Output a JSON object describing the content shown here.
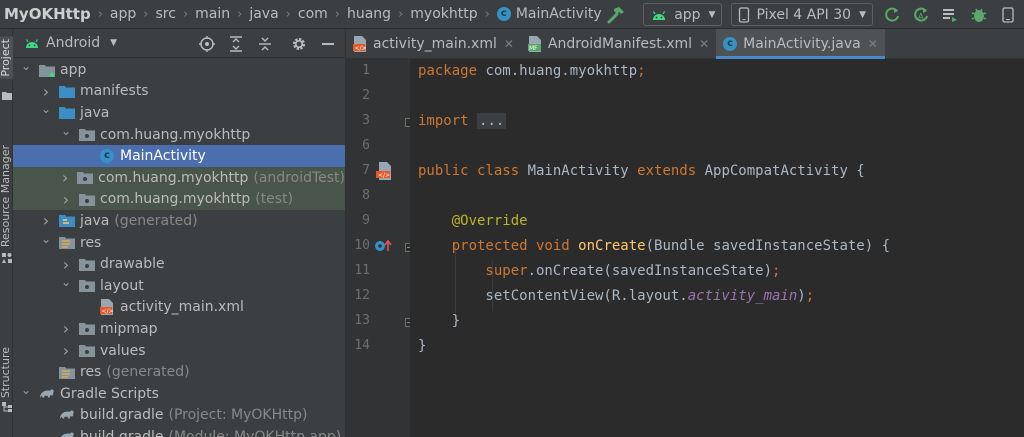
{
  "breadcrumbs": [
    {
      "label": "MyOKHttp",
      "kind": "root"
    },
    {
      "label": "app"
    },
    {
      "label": "src"
    },
    {
      "label": "main"
    },
    {
      "label": "java"
    },
    {
      "label": "com"
    },
    {
      "label": "huang"
    },
    {
      "label": "myokhttp"
    },
    {
      "label": "MainActivity",
      "kind": "class"
    }
  ],
  "toolbar": {
    "run_config": "app",
    "device": "Pixel 4 API 30"
  },
  "tool_stripe": {
    "project": "Project",
    "resource_manager": "Resource Manager",
    "structure": "Structure"
  },
  "project_panel": {
    "view_mode": "Android",
    "tree": [
      {
        "label": "app",
        "depth": 0,
        "arrow": "down",
        "icon": "module-icon"
      },
      {
        "label": "manifests",
        "depth": 1,
        "arrow": "right",
        "icon": "folder-icon"
      },
      {
        "label": "java",
        "depth": 1,
        "arrow": "down",
        "icon": "folder-icon"
      },
      {
        "label": "com.huang.myokhttp",
        "depth": 2,
        "arrow": "down",
        "icon": "package-icon"
      },
      {
        "label": "MainActivity",
        "depth": 3,
        "arrow": "none",
        "icon": "class-icon",
        "selected": true
      },
      {
        "label": "com.huang.myokhttp",
        "suffix": "(androidTest)",
        "depth": 2,
        "arrow": "right",
        "icon": "package-icon",
        "test": true
      },
      {
        "label": "com.huang.myokhttp",
        "suffix": "(test)",
        "depth": 2,
        "arrow": "right",
        "icon": "package-icon",
        "test": true
      },
      {
        "label": "java",
        "suffix": "(generated)",
        "depth": 1,
        "arrow": "right",
        "icon": "generated-folder-icon"
      },
      {
        "label": "res",
        "depth": 1,
        "arrow": "down",
        "icon": "res-folder-icon"
      },
      {
        "label": "drawable",
        "depth": 2,
        "arrow": "right",
        "icon": "package-icon"
      },
      {
        "label": "layout",
        "depth": 2,
        "arrow": "down",
        "icon": "package-icon"
      },
      {
        "label": "activity_main.xml",
        "depth": 3,
        "arrow": "none",
        "icon": "layout-file-icon"
      },
      {
        "label": "mipmap",
        "depth": 2,
        "arrow": "right",
        "icon": "package-icon"
      },
      {
        "label": "values",
        "depth": 2,
        "arrow": "right",
        "icon": "package-icon"
      },
      {
        "label": "res",
        "suffix": "(generated)",
        "depth": 1,
        "arrow": "none",
        "icon": "res-folder-icon"
      },
      {
        "label": "Gradle Scripts",
        "depth": 0,
        "arrow": "down",
        "icon": "gradle-icon"
      },
      {
        "label": "build.gradle",
        "suffix": "(Project: MyOKHttp)",
        "depth": 1,
        "arrow": "none",
        "icon": "gradle-icon"
      },
      {
        "label": "build.gradle",
        "suffix": "(Module: MyOKHttp.app)",
        "depth": 1,
        "arrow": "none",
        "icon": "gradle-icon"
      }
    ]
  },
  "editor": {
    "tabs": [
      {
        "label": "activity_main.xml",
        "icon": "layout-file-icon",
        "active": false
      },
      {
        "label": "AndroidManifest.xml",
        "icon": "manifest-file-icon",
        "active": false
      },
      {
        "label": "MainActivity.java",
        "icon": "class-icon",
        "active": true
      }
    ],
    "code_lines": [
      {
        "num": "1",
        "tokens": [
          {
            "t": "package ",
            "c": "kw"
          },
          {
            "t": "com.huang.myokhttp"
          },
          {
            "t": ";",
            "c": "kw"
          }
        ]
      },
      {
        "num": "2",
        "tokens": []
      },
      {
        "num": "3",
        "tokens": [
          {
            "t": "import ",
            "c": "kw"
          },
          {
            "t": "...",
            "c": "fold-box"
          }
        ],
        "fold": "closed"
      },
      {
        "num": "6",
        "tokens": []
      },
      {
        "num": "7",
        "tokens": [
          {
            "t": "public class ",
            "c": "kw"
          },
          {
            "t": "MainActivity "
          },
          {
            "t": "extends ",
            "c": "kw"
          },
          {
            "t": "AppCompatActivity {"
          }
        ],
        "gutter_icon": "activity-layout-icon"
      },
      {
        "num": "8",
        "tokens": []
      },
      {
        "num": "9",
        "tokens": [
          {
            "t": "    @Override",
            "c": "an"
          }
        ]
      },
      {
        "num": "10",
        "tokens": [
          {
            "t": "    protected void ",
            "c": "kw"
          },
          {
            "t": "onCreate",
            "c": "fn"
          },
          {
            "t": "(Bundle savedInstanceState) {"
          }
        ],
        "fold": "open",
        "gutter_icon": "override-method-icon"
      },
      {
        "num": "11",
        "tokens": [
          {
            "t": "        super",
            "c": "kw"
          },
          {
            "t": ".onCreate(savedInstanceState)"
          },
          {
            "t": ";",
            "c": "kw"
          }
        ]
      },
      {
        "num": "12",
        "tokens": [
          {
            "t": "        setContentView(R.layout."
          },
          {
            "t": "activity_main",
            "c": "it"
          },
          {
            "t": ")"
          },
          {
            "t": ";",
            "c": "kw"
          }
        ]
      },
      {
        "num": "13",
        "tokens": [
          {
            "t": "    }"
          }
        ],
        "fold": "open"
      },
      {
        "num": "14",
        "tokens": [
          {
            "t": "}"
          }
        ]
      }
    ]
  }
}
